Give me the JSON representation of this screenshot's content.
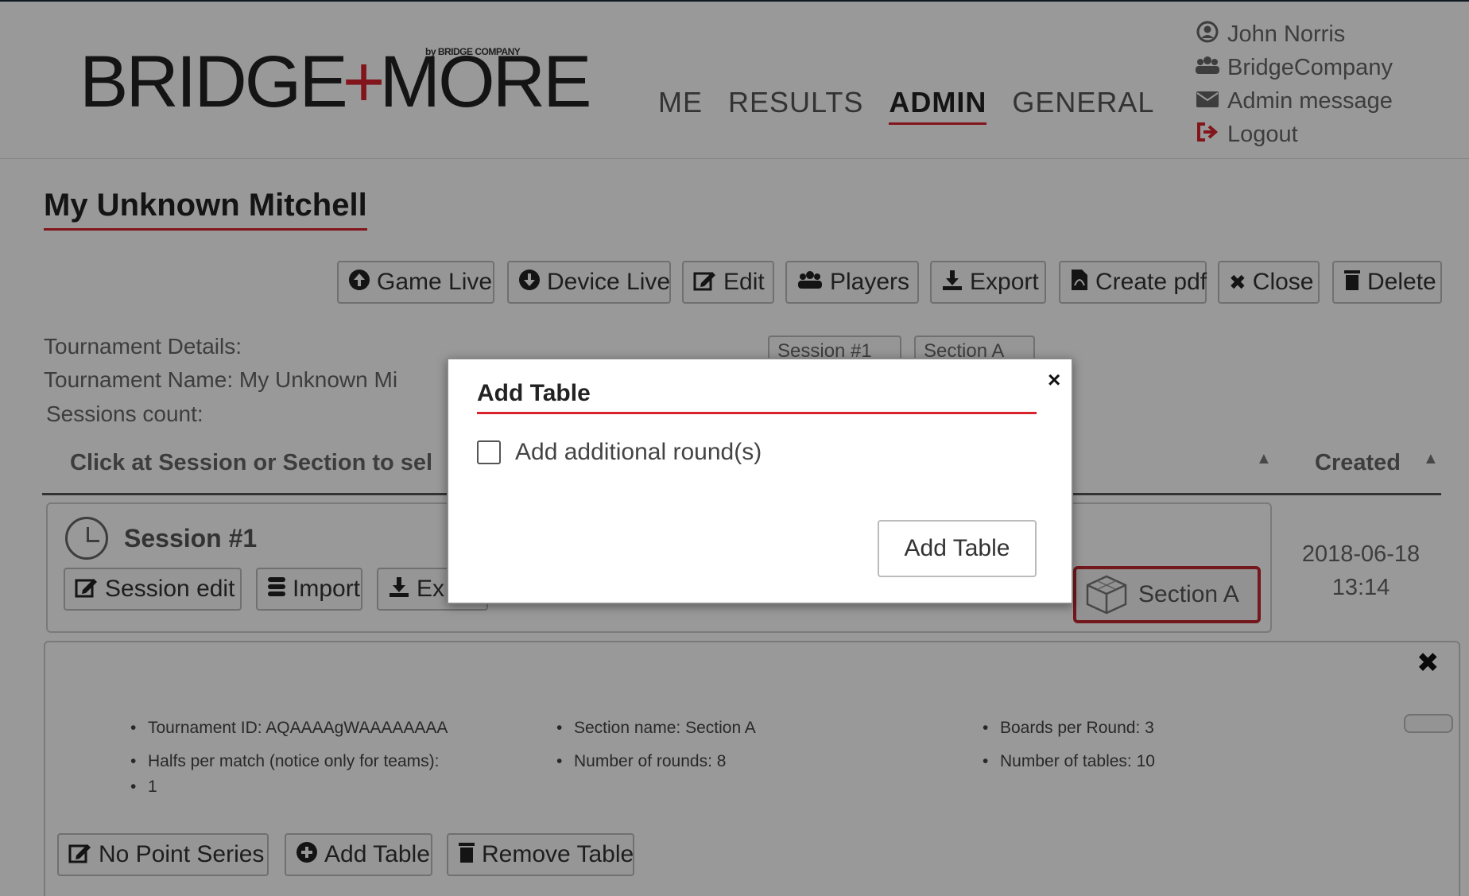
{
  "header": {
    "logo_left": "BRIDGE",
    "logo_plus": "+",
    "logo_right": "MORE",
    "logo_sub": "by BRIDGE COMPANY",
    "nav": [
      "ME",
      "RESULTS",
      "ADMIN",
      "GENERAL"
    ],
    "nav_active": "ADMIN",
    "user_menu": {
      "user": "John Norris",
      "company": "BridgeCompany",
      "admin_message": "Admin message",
      "logout": "Logout"
    }
  },
  "page": {
    "title": "My Unknown Mitchell"
  },
  "toolbar": {
    "game_live": "Game Live",
    "device_live": "Device Live",
    "edit": "Edit",
    "players": "Players",
    "export": "Export",
    "create_pdf": "Create pdf",
    "close": "Close",
    "delete": "Delete"
  },
  "details": {
    "heading": "Tournament Details:",
    "name": "Tournament Name: My Unknown Mi",
    "sessions_count": "Sessions count:"
  },
  "tabs": {
    "session": "Session #1",
    "section": "Section A"
  },
  "table": {
    "hint": "Click at Session or Section to sel",
    "created_header": "Created"
  },
  "session": {
    "title": "Session #1",
    "session_edit": "Session edit",
    "import": "Import",
    "export_partial": "Ex",
    "section_label": "Section A",
    "created_date": "2018-06-18",
    "created_time": "13:14"
  },
  "section_details": {
    "tournament_id": "Tournament ID: AQAAAAgWAAAAAAAA",
    "halfs": "Halfs per match (notice only for teams):",
    "halfs_value": "1",
    "section_name": "Section name: Section A",
    "rounds": "Number of rounds: 8",
    "boards": "Boards per Round: 3",
    "tables": "Number of tables: 10",
    "no_point_series": "No Point Series",
    "add_table": "Add Table",
    "remove_table": "Remove Table"
  },
  "modal": {
    "title": "Add Table",
    "checkbox_label": "Add additional round(s)",
    "submit": "Add Table",
    "close": "×"
  }
}
